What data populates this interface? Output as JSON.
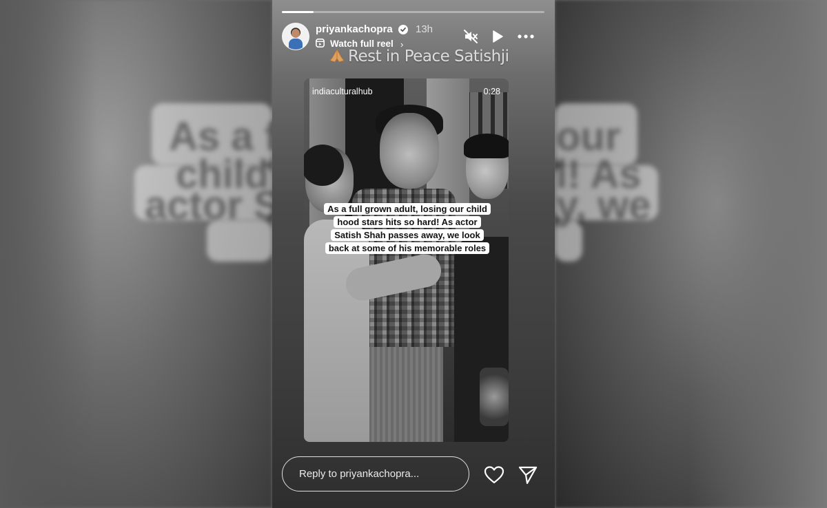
{
  "story": {
    "username": "priyankachopra",
    "time_ago": "13h",
    "watch_full_reel": "Watch full reel",
    "caption": "Rest in Peace Satishji",
    "progress": 0.12
  },
  "reel": {
    "username": "indiaculturalhub",
    "duration": "0:28",
    "caption": "As a full grown adult, losing our child hood stars hits so hard! As actor Satish Shah passes away, we look back at some of his memorable roles"
  },
  "background_text": {
    "left_line1": "As a full",
    "left_line2": "child ho",
    "left_line3": "actor Sat",
    "right_line1": "our",
    "right_line2": "l! As",
    "right_line3": "y, we"
  },
  "footer": {
    "reply_placeholder": "Reply to priyankachopra..."
  },
  "icons": {
    "verified": "verified-badge-icon",
    "mute": "speaker-muted-icon",
    "play": "play-icon",
    "more": "more-options-icon",
    "reel": "reel-icon",
    "like": "heart-icon",
    "share": "send-icon",
    "caption_emoji": "folded-hands-emoji"
  }
}
